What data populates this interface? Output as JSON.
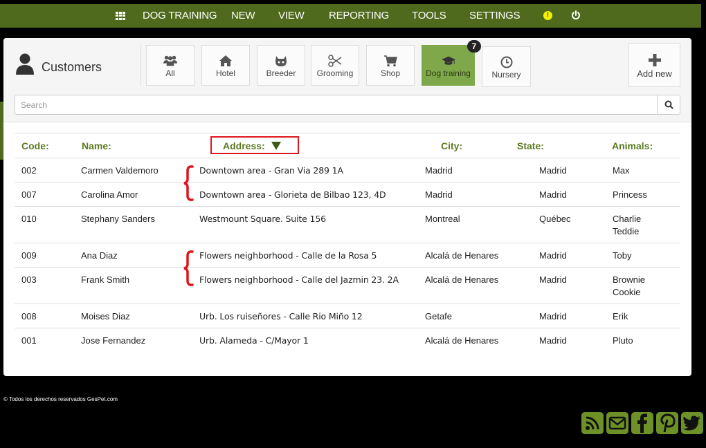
{
  "topnav": {
    "items": [
      "DOG TRAINING",
      "NEW",
      "VIEW",
      "REPORTING",
      "TOOLS",
      "SETTINGS"
    ],
    "alert_symbol": "!"
  },
  "header": {
    "title": "Customers"
  },
  "filters": [
    {
      "label": "All",
      "icon": "users-icon"
    },
    {
      "label": "Hotel",
      "icon": "home-icon"
    },
    {
      "label": "Breeder",
      "icon": "cat-icon"
    },
    {
      "label": "Grooming",
      "icon": "scissors-icon"
    },
    {
      "label": "Shop",
      "icon": "cart-icon"
    },
    {
      "label": "Dog training",
      "icon": "graduation-cap-icon",
      "active": true,
      "badge": "7"
    },
    {
      "label": "Nursery",
      "icon": "clock-icon"
    }
  ],
  "add_new": {
    "label": "Add new",
    "icon": "plus-icon"
  },
  "search": {
    "placeholder": "Search",
    "value": ""
  },
  "table": {
    "columns": [
      "Code:",
      "Name:",
      "Address:",
      "City:",
      "State:",
      "Animals:"
    ],
    "sorted_by": "Address:",
    "rows": [
      {
        "code": "002",
        "name": "Carmen Valdemoro",
        "address": "Downtown area - Gran Via 289 1A",
        "city": "Madrid",
        "state": "Madrid",
        "animals": [
          "Max"
        ]
      },
      {
        "code": "007",
        "name": "Carolina Amor",
        "address": "Downtown area - Glorieta de Bilbao 123, 4D",
        "city": "Madrid",
        "state": "Madrid",
        "animals": [
          "Princess"
        ]
      },
      {
        "code": "010",
        "name": "Stephany Sanders",
        "address": "Westmount Square. Suite 156",
        "city": "Montreal",
        "state": "Québec",
        "animals": [
          "Charlie",
          "Teddie"
        ]
      },
      {
        "code": "009",
        "name": "Ana Diaz",
        "address": "Flowers neighborhood - Calle de la Rosa 5",
        "city": "Alcalá de Henares",
        "state": "Madrid",
        "animals": [
          "Toby"
        ]
      },
      {
        "code": "003",
        "name": "Frank Smith",
        "address": "Flowers neighborhood - Calle del Jazmin 23. 2A",
        "city": "Alcalá de Henares",
        "state": "Madrid",
        "animals": [
          "Brownie",
          "Cookie"
        ]
      },
      {
        "code": "008",
        "name": "Moises Diaz",
        "address": "Urb. Los ruiseñores - Calle Rio Miño 12",
        "city": "Getafe",
        "state": "Madrid",
        "animals": [
          "Erik"
        ]
      },
      {
        "code": "001",
        "name": "Jose Fernandez",
        "address": "Urb. Alameda - C/Mayor 1",
        "city": "Alcalá de Henares",
        "state": "Madrid",
        "animals": [
          "Pluto"
        ]
      }
    ]
  },
  "footer": {
    "copyright": "©   Todos los derechos reservados GesPet.com",
    "social": [
      "rss-icon",
      "mail-icon",
      "facebook-icon",
      "pinterest-icon",
      "twitter-icon"
    ]
  },
  "colors": {
    "nav_green": "#4f6a1d",
    "active_green": "#7ea84a",
    "header_text": "#5b7a22",
    "annotation_red": "#e0141c",
    "social_green": "#6e9127"
  }
}
